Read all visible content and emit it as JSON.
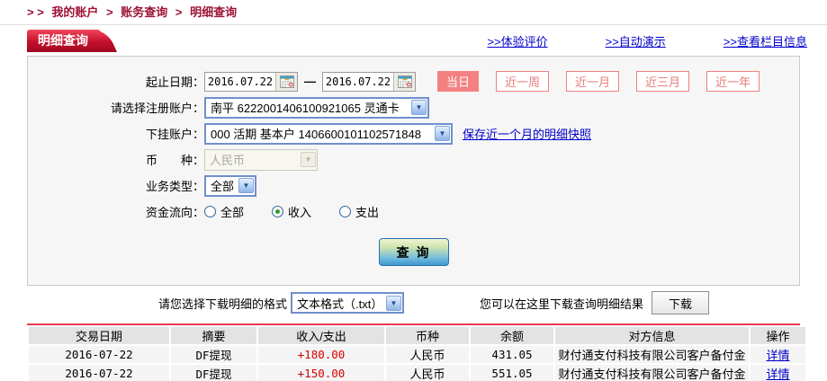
{
  "colors": {
    "accent_red": "#c50f2c",
    "breadcrumb_red": "#9e1235",
    "link_blue": "#0000cc",
    "amount_red": "#d40000",
    "salmon": "#f08080",
    "query_button_blue": "#3f97cc"
  },
  "breadcrumb": {
    "prefix": "> >",
    "separator": ">",
    "items": [
      "我的账户",
      "账务查询",
      "明细查询"
    ]
  },
  "tab": {
    "label": "明细查询"
  },
  "header_links": {
    "experience": ">>体验评价",
    "demo": ">>自动演示",
    "column_info": ">>查看栏目信息"
  },
  "form": {
    "date": {
      "label": "起止日期：",
      "from": "2016.07.22",
      "to": "2016.07.22",
      "separator": "—",
      "calendar_icon": "calendar",
      "quick": [
        {
          "label": "当日",
          "active": true
        },
        {
          "label": "近一周",
          "active": false
        },
        {
          "label": "近一月",
          "active": false
        },
        {
          "label": "近三月",
          "active": false
        },
        {
          "label": "近一年",
          "active": false
        }
      ]
    },
    "register_account": {
      "label": "请选择注册账户：",
      "value": "南平  6222001406100921065 灵通卡"
    },
    "sub_account": {
      "label": "下挂账户：",
      "value": "000  活期  基本户  1406600101102571848",
      "snapshot_link": "保存近一个月的明细快照"
    },
    "currency": {
      "label": "币　　种：",
      "value": "人民币"
    },
    "biz_type": {
      "label": "业务类型：",
      "value": "全部"
    },
    "flow": {
      "label": "资金流向：",
      "options": [
        {
          "label": "全部",
          "checked": false
        },
        {
          "label": "收入",
          "checked": true
        },
        {
          "label": "支出",
          "checked": false
        }
      ]
    },
    "query_button": "查 询"
  },
  "download": {
    "format_label": "请您选择下载明细的格式",
    "format_value": "文本格式（.txt）",
    "hint": "您可以在这里下载查询明细结果",
    "button": "下载"
  },
  "table": {
    "headers": [
      "交易日期",
      "摘要",
      "收入/支出",
      "币种",
      "余额",
      "对方信息",
      "操作"
    ],
    "rows": [
      {
        "date": "2016-07-22",
        "summary": "DF提现",
        "amount": "+180.00",
        "currency": "人民币",
        "balance": "431.05",
        "counterparty": "财付通支付科技有限公司客户备付金",
        "action": "详情"
      },
      {
        "date": "2016-07-22",
        "summary": "DF提现",
        "amount": "+150.00",
        "currency": "人民币",
        "balance": "551.05",
        "counterparty": "财付通支付科技有限公司客户备付金",
        "action": "详情"
      }
    ]
  }
}
